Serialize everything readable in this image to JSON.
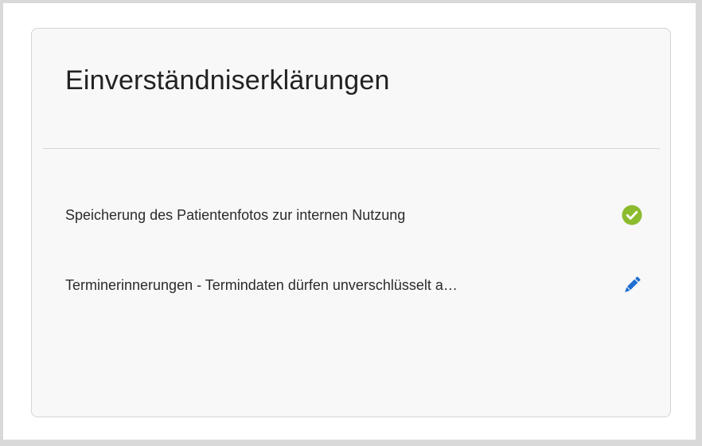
{
  "card": {
    "title": "Einverständniserklärungen"
  },
  "consents": [
    {
      "label": "Speicherung des Patientenfotos zur internen Nutzung",
      "status": "granted",
      "icon": "check-circle-icon",
      "color": "#8cbc2e"
    },
    {
      "label": "Terminerinnerungen - Termindaten dürfen unverschlüsselt a…",
      "status": "pending",
      "icon": "pencil-icon",
      "color": "#1f6fd1"
    }
  ]
}
